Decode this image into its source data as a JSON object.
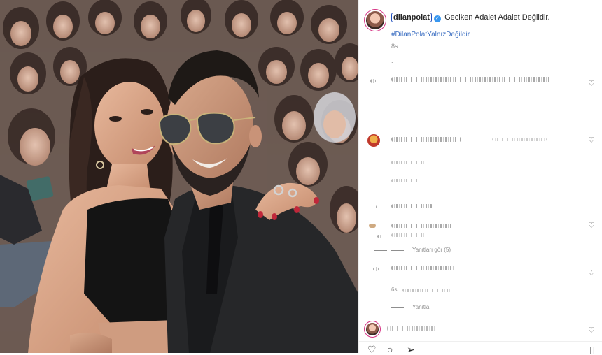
{
  "post": {
    "username": "dilanpolat",
    "verified_icon": "verified-badge-icon",
    "caption": "Geciken Adalet Adalet Değildir.",
    "hashtag": "#DilanPolatYalnızDeğildir",
    "time_ago": "8s",
    "separator": "."
  },
  "comments": {
    "replies_1": "Yanıtları gör (5)",
    "time_2": "6s",
    "replies_2": "Yanıtla"
  },
  "icons": {
    "heart": "heart-icon",
    "comment": "comment-icon",
    "share": "share-icon",
    "save": "bookmark-icon"
  },
  "colors": {
    "accent": "#3b6ec2",
    "verified": "#3897f0",
    "muted": "#8e8e8e"
  }
}
